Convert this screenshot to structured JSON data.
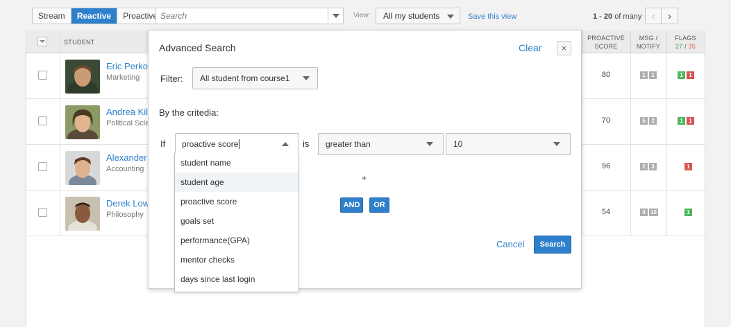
{
  "toolbar": {
    "modes": [
      "Stream",
      "Reactive",
      "Proactive"
    ],
    "active_mode": "Reactive",
    "search_placeholder": "Search",
    "view_label": "View:",
    "view_value": "All my students",
    "save_view": "Save this view",
    "paging_range": "1 - 20",
    "paging_suffix": "of many",
    "prev_icon": "‹",
    "next_icon": "›"
  },
  "table": {
    "headers": {
      "student": "STUDENT",
      "proactive_score": [
        "PROACTIVE",
        "SCORE"
      ],
      "msg_notify": [
        "MSG /",
        "NOTIFY"
      ],
      "flags": "FLAGS",
      "flags_green": "27",
      "flags_slash": " / ",
      "flags_red": "35"
    },
    "rows": [
      {
        "name": "Eric Perko",
        "major": "Marketing",
        "score": "80",
        "msg": [
          "1",
          "1"
        ],
        "flags": [
          {
            "v": "1",
            "c": "green"
          },
          {
            "v": "1",
            "c": "red"
          }
        ],
        "avatar_colors": [
          "#6b4a2c",
          "#c99c74",
          "#2f3b2a"
        ]
      },
      {
        "name": "Andrea Kilg",
        "major": "Political Scier",
        "score": "70",
        "msg": [
          "5",
          "2"
        ],
        "flags": [
          {
            "v": "1",
            "c": "green"
          },
          {
            "v": "1",
            "c": "red"
          }
        ],
        "avatar_colors": [
          "#4a3a22",
          "#e2b58e",
          "#8c9a66"
        ]
      },
      {
        "name": "Alexander M",
        "major": "Accounting",
        "score": "96",
        "msg": [
          "2",
          "3"
        ],
        "flags": [
          {
            "v": "1",
            "c": "red"
          }
        ],
        "avatar_colors": [
          "#5b3a24",
          "#deb28e",
          "#d8d8d8"
        ]
      },
      {
        "name": "Derek Lowe",
        "major": "Philosophy",
        "score": "54",
        "msg": [
          "4",
          "10"
        ],
        "flags": [
          {
            "v": "1",
            "c": "green"
          }
        ],
        "avatar_colors": [
          "#2a1a10",
          "#8a5a3c",
          "#c8c0b0"
        ]
      }
    ]
  },
  "modal": {
    "title": "Advanced Search",
    "clear": "Clear",
    "close_icon": "×",
    "filter_label": "Filter:",
    "filter_value": "All student from course1",
    "criteria_label": "By the critedia:",
    "if_label": "If",
    "field_value": "proactive score",
    "is_label": "is",
    "operator_value": "greater than",
    "value_value": "10",
    "plus": "+",
    "and_label": "AND",
    "or_label": "OR",
    "cancel_label": "Cancel",
    "search_label": "Search"
  },
  "dropdown": {
    "options": [
      "student name",
      "student age",
      "proactive score",
      "goals set",
      "performance(GPA)",
      "mentor checks",
      "days since last login"
    ],
    "highlighted": "student age"
  },
  "colors": {
    "accent": "#2e7fcc",
    "flag_green": "#4cb85c",
    "flag_red": "#d9534f",
    "badge_grey": "#aeaeae"
  }
}
